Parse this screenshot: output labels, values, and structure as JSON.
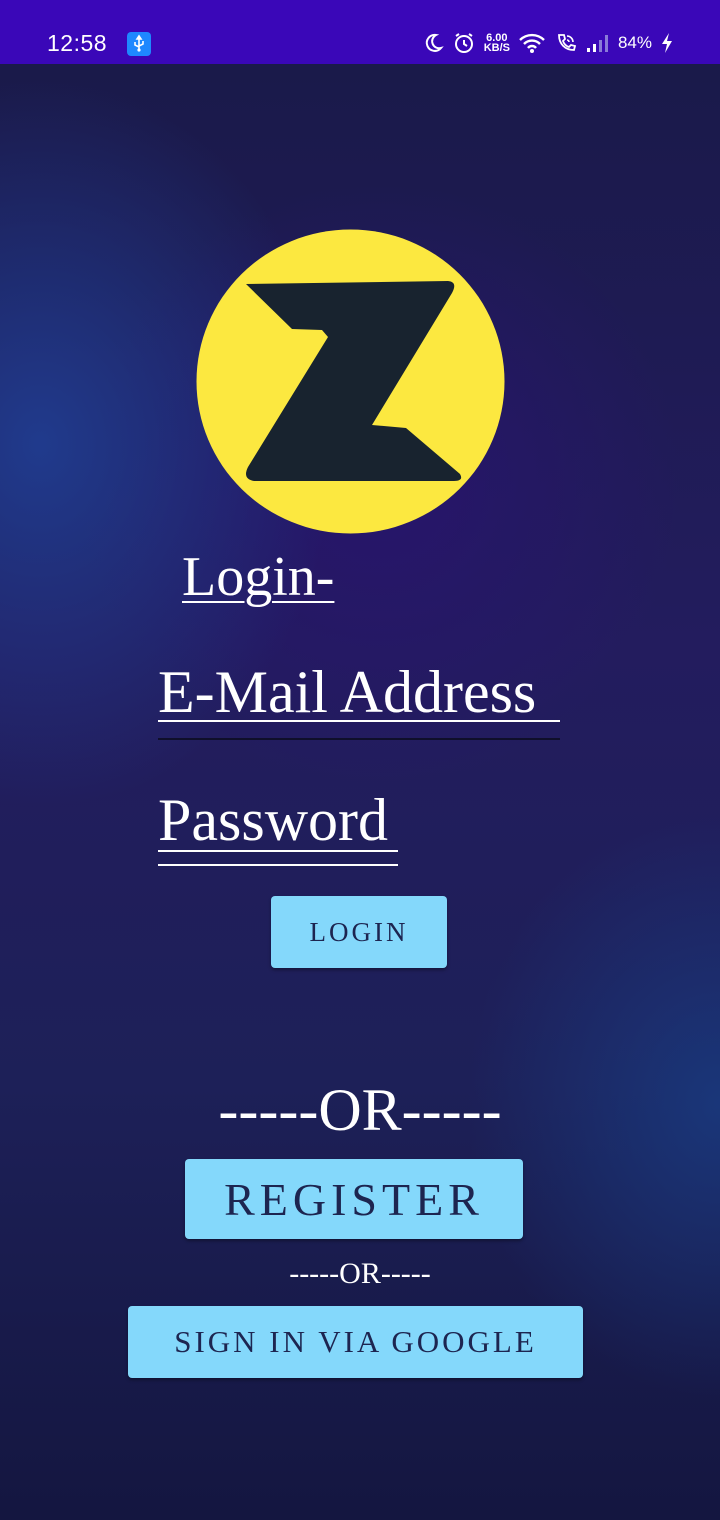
{
  "status_bar": {
    "time": "12:58",
    "net_speed_value": "6.00",
    "net_speed_unit": "KB/S",
    "battery": "84%",
    "icons": [
      "usb-debug-icon",
      "do-not-disturb-icon",
      "alarm-icon",
      "wifi-icon",
      "wifi-call-icon",
      "signal-icon",
      "charging-icon"
    ]
  },
  "logo": {
    "letter": "Z",
    "circle_color": "#fce840",
    "letter_color": "#18232f"
  },
  "login": {
    "heading": "Login-",
    "email_placeholder": "E-Mail Address",
    "password_placeholder": "Password",
    "login_button": "LOGIN"
  },
  "separator_1": "-----OR-----",
  "register_button": "REGISTER",
  "separator_2": "-----OR-----",
  "google_button": "SIGN IN VIA GOOGLE",
  "colors": {
    "button": "#84d8fb",
    "button_text": "#1d2550",
    "status_bar": "#3a07b8"
  }
}
